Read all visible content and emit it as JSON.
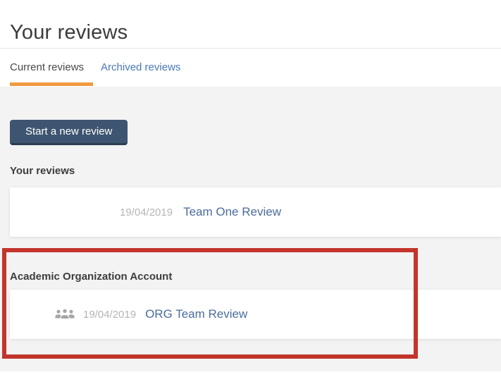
{
  "page": {
    "title": "Your reviews"
  },
  "tabs": [
    {
      "label": "Current reviews",
      "active": true
    },
    {
      "label": "Archived reviews",
      "active": false
    }
  ],
  "toolbar": {
    "new_review_label": "Start a new review"
  },
  "sections": [
    {
      "heading": "Your reviews",
      "rows": [
        {
          "icon": null,
          "date": "19/04/2019",
          "title": "Team One Review"
        }
      ]
    },
    {
      "heading": "Academic Organization Account",
      "highlighted": true,
      "rows": [
        {
          "icon": "group-icon",
          "date": "19/04/2019",
          "title": "ORG Team Review"
        }
      ]
    }
  ],
  "colors": {
    "accent_orange": "#F09A3E",
    "tab_inactive_link": "#4A79B5",
    "review_link_blue": "#4A6C9B",
    "button_bg": "#3E5571",
    "button_edge": "#2B3E52",
    "content_bg": "#F3F3F3",
    "date_grey": "#B5B5B5",
    "annotation_red": "#C2352B"
  }
}
